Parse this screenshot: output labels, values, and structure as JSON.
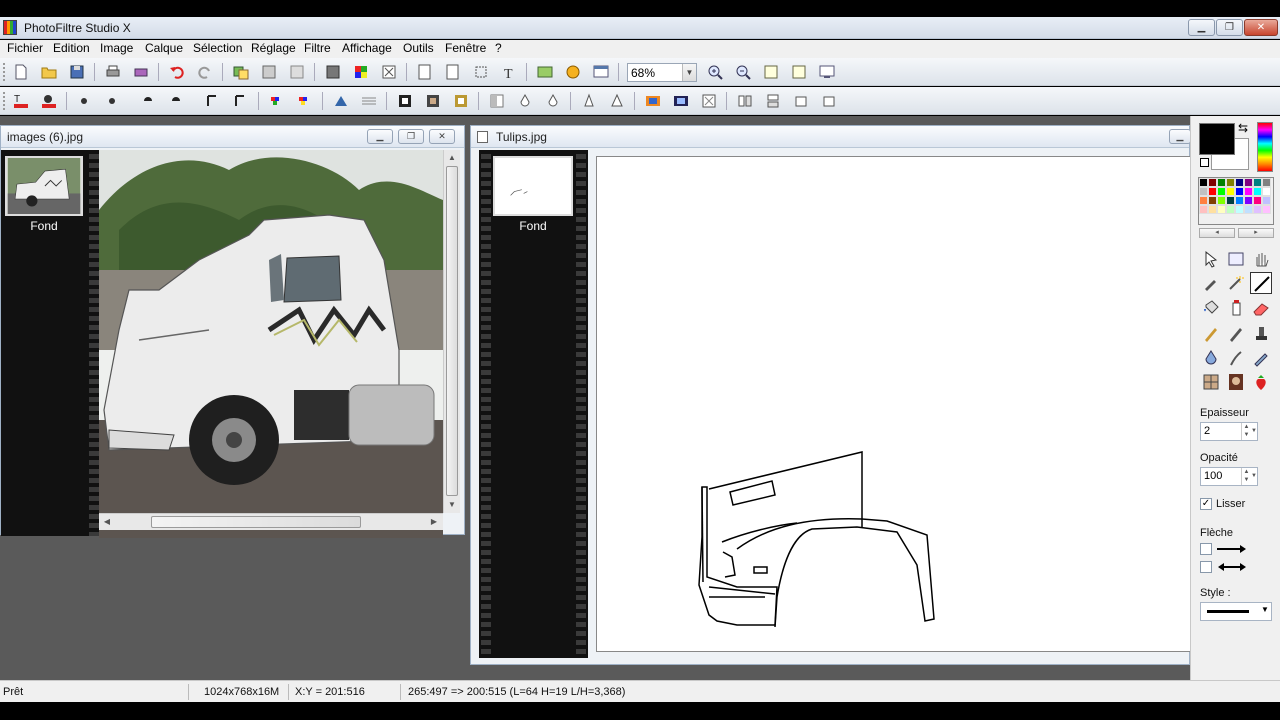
{
  "app": {
    "title": "PhotoFiltre Studio X"
  },
  "menu": [
    "Fichier",
    "Edition",
    "Image",
    "Calque",
    "Sélection",
    "Réglage",
    "Filtre",
    "Affichage",
    "Outils",
    "Fenêtre",
    "?"
  ],
  "toolbar": {
    "zoom": "68%"
  },
  "windows": {
    "left": {
      "title": "images (6).jpg",
      "layer_label": "Fond"
    },
    "right": {
      "title": "Tulips.jpg",
      "layer_label": "Fond"
    }
  },
  "palette": {
    "thickness_label": "Epaisseur",
    "thickness_value": "2",
    "opacity_label": "Opacité",
    "opacity_value": "100",
    "smooth_label": "Lisser",
    "smooth_checked": true,
    "arrow_label": "Flèche",
    "style_label": "Style :",
    "swatch_colors": [
      "#000000",
      "#800000",
      "#008000",
      "#808000",
      "#000080",
      "#800080",
      "#008080",
      "#808080",
      "#c0c0c0",
      "#ff0000",
      "#00ff00",
      "#ffff00",
      "#0000ff",
      "#ff00ff",
      "#00ffff",
      "#ffffff",
      "#ff8040",
      "#804000",
      "#80ff00",
      "#004040",
      "#0080ff",
      "#8000ff",
      "#ff0080",
      "#c0c0ff",
      "#ffc0c0",
      "#ffe0a0",
      "#ffffc0",
      "#c0ffc0",
      "#c0ffff",
      "#c0e0ff",
      "#e0c0ff",
      "#ffc0ff"
    ]
  },
  "status": {
    "state": "Prêt",
    "dimensions": "1024x768x16M",
    "cursor": "X:Y = 201:516",
    "selection": "265:497 => 200:515 (L=64  H=19  L/H=3,368)"
  }
}
